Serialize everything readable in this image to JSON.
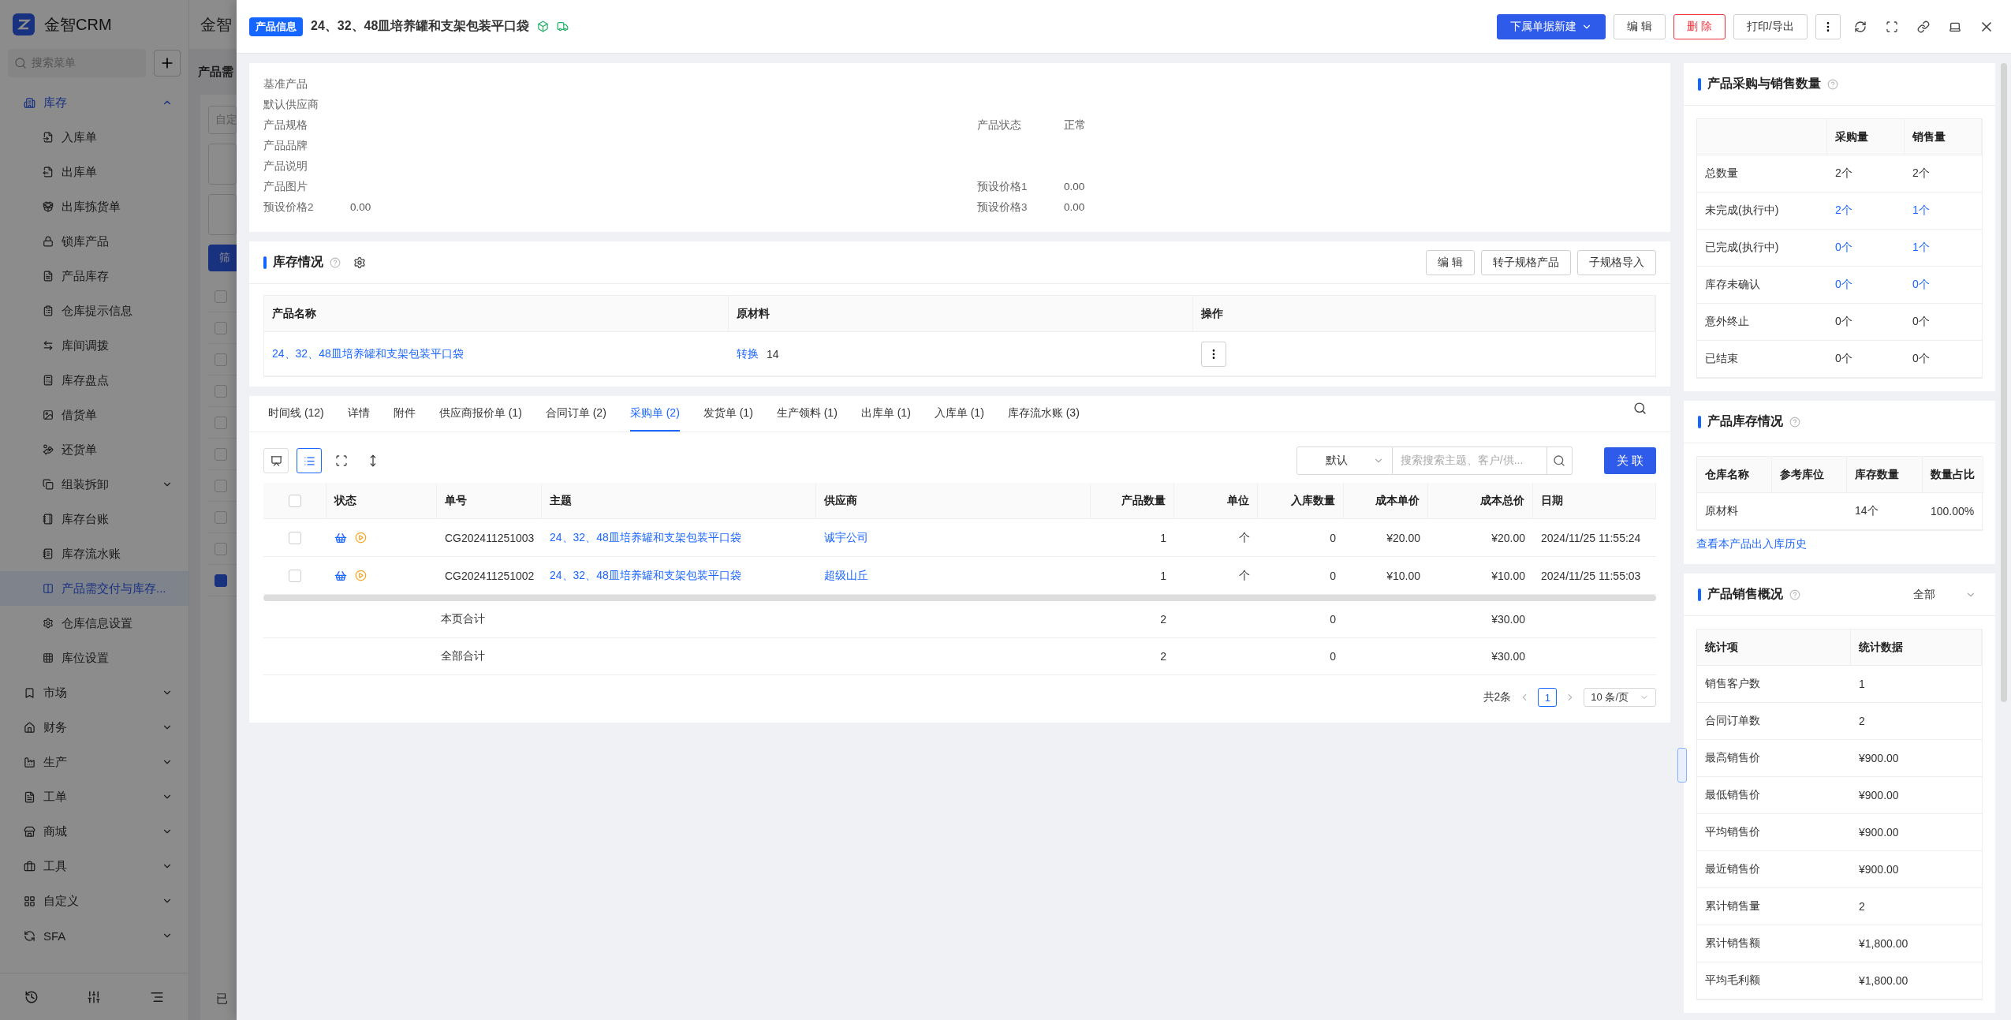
{
  "backdrop": {
    "app_name": "金智CRM",
    "search_placeholder": "搜索菜单",
    "menu": [
      {
        "label": "库存",
        "expanded": true,
        "children": [
          {
            "label": "入库单",
            "kind": "item",
            "selected": false
          },
          {
            "label": "出库单",
            "kind": "item",
            "selected": false
          },
          {
            "label": "出库拣货单",
            "kind": "item",
            "selected": false
          },
          {
            "label": "锁库产品",
            "kind": "item",
            "selected": false
          },
          {
            "label": "产品库存",
            "kind": "item",
            "selected": false
          },
          {
            "label": "仓库提示信息",
            "kind": "item",
            "selected": false
          },
          {
            "label": "库间调拨",
            "kind": "item",
            "selected": false
          },
          {
            "label": "库存盘点",
            "kind": "item",
            "selected": false
          },
          {
            "label": "借货单",
            "kind": "item",
            "selected": false
          },
          {
            "label": "还货单",
            "kind": "item",
            "selected": false
          },
          {
            "label": "组装拆卸",
            "kind": "group",
            "selected": false
          },
          {
            "label": "库存台账",
            "kind": "item",
            "selected": false
          },
          {
            "label": "库存流水账",
            "kind": "item",
            "selected": false
          },
          {
            "label": "产品需交付与库存...",
            "kind": "item",
            "selected": true
          },
          {
            "label": "仓库信息设置",
            "kind": "item",
            "selected": false
          },
          {
            "label": "库位设置",
            "kind": "item",
            "selected": false
          }
        ]
      },
      {
        "label": "市场",
        "expanded": false
      },
      {
        "label": "财务",
        "expanded": false
      },
      {
        "label": "生产",
        "expanded": false
      },
      {
        "label": "工单",
        "expanded": false
      },
      {
        "label": "商城",
        "expanded": false
      },
      {
        "label": "工具",
        "expanded": false
      },
      {
        "label": "自定义",
        "expanded": false
      },
      {
        "label": "SFA",
        "expanded": false
      }
    ],
    "header_title": "金智",
    "page_title": "产品需",
    "field_placeholder": "自定",
    "filter_button": "筛",
    "footer_text": "已",
    "rows": [
      {
        "checked": false
      },
      {
        "checked": false
      },
      {
        "checked": false
      },
      {
        "checked": false
      },
      {
        "checked": false
      },
      {
        "checked": false
      },
      {
        "checked": false
      },
      {
        "checked": false
      },
      {
        "checked": false
      },
      {
        "checked": true
      }
    ]
  },
  "drawer": {
    "badge": "产品信息",
    "title": "24、32、48皿培养罐和支架包装平口袋",
    "actions": [
      {
        "label": "下属单据新建",
        "kind": "primary"
      },
      {
        "label": "编 辑",
        "kind": "default"
      },
      {
        "label": "删 除",
        "kind": "danger"
      },
      {
        "label": "打印/导出",
        "kind": "default"
      }
    ]
  },
  "info": {
    "rows": [
      {
        "left": {
          "label": "基准产品"
        }
      },
      {
        "left": {
          "label": "默认供应商"
        }
      },
      {
        "left": {
          "label": "产品规格"
        },
        "right": {
          "label": "产品状态",
          "value": "正常"
        }
      },
      {
        "left": {
          "label": "产品品牌"
        }
      },
      {
        "left": {
          "label": "产品说明"
        }
      },
      {
        "left": {
          "label": "产品图片"
        },
        "right": {
          "label": "预设价格1",
          "value": "0.00"
        }
      },
      {
        "left": {
          "label": "预设价格2",
          "value": "0.00"
        },
        "right": {
          "label": "预设价格3",
          "value": "0.00"
        }
      }
    ]
  },
  "stock": {
    "title": "库存情况",
    "buttons": [
      "编 辑",
      "转子规格产品",
      "子规格导入"
    ],
    "columns": [
      "产品名称",
      "原材料",
      "操作"
    ],
    "rows": [
      {
        "name": "24、32、48皿培养罐和支架包装平口袋",
        "action": "转换",
        "quantity": "14"
      }
    ]
  },
  "tabs": [
    {
      "label": "时间线 (12)",
      "selected": false
    },
    {
      "label": "详情",
      "selected": false
    },
    {
      "label": "附件",
      "selected": false
    },
    {
      "label": "供应商报价单 (1)",
      "selected": false
    },
    {
      "label": "合同订单 (2)",
      "selected": false
    },
    {
      "label": "采购单 (2)",
      "selected": true
    },
    {
      "label": "发货单 (1)",
      "selected": false
    },
    {
      "label": "生产领料 (1)",
      "selected": false
    },
    {
      "label": "出库单 (1)",
      "selected": false
    },
    {
      "label": "入库单 (1)",
      "selected": false
    },
    {
      "label": "库存流水账 (3)",
      "selected": false
    }
  ],
  "orders": {
    "select_all": {
      "checked": false
    },
    "view_modes": [
      {
        "selected": false
      },
      {
        "selected": true
      }
    ],
    "filter_select": "默认",
    "search_placeholder": "搜索搜索主题、客户/供...",
    "link_button": "关 联",
    "columns": [
      "状态",
      "单号",
      "主题",
      "供应商",
      "产品数量",
      "单位",
      "入库数量",
      "成本单价",
      "成本总价",
      "日期"
    ],
    "rows": [
      {
        "checked": false,
        "number": "CG202411251003",
        "subject": "24、32、48皿培养罐和支架包装平口袋",
        "supplier": "诚宇公司",
        "qty": "1",
        "unit": "个",
        "in_qty": "0",
        "unit_cost": "¥20.00",
        "total_cost": "¥20.00",
        "date": "2024/11/25 11:55:24"
      },
      {
        "checked": false,
        "number": "CG202411251002",
        "subject": "24、32、48皿培养罐和支架包装平口袋",
        "supplier": "超级山丘",
        "qty": "1",
        "unit": "个",
        "in_qty": "0",
        "unit_cost": "¥10.00",
        "total_cost": "¥10.00",
        "date": "2024/11/25 11:55:03"
      }
    ],
    "totals": [
      {
        "label": "本页合计",
        "qty": "2",
        "in_qty": "0",
        "total_cost": "¥30.00"
      },
      {
        "label": "全部合计",
        "qty": "2",
        "in_qty": "0",
        "total_cost": "¥30.00"
      }
    ],
    "pagination": {
      "total": "共2条",
      "page": "1",
      "page_size": "10 条/页"
    }
  },
  "purchase_sales": {
    "title": "产品采购与销售数量",
    "columns": [
      "采购量",
      "销售量"
    ],
    "rows": [
      {
        "label": "总数量",
        "cells": [
          {
            "text": "2个",
            "link": false
          },
          {
            "text": "2个",
            "link": false
          }
        ]
      },
      {
        "label": "未完成(执行中)",
        "cells": [
          {
            "text": "2个",
            "link": true
          },
          {
            "text": "1个",
            "link": true
          }
        ]
      },
      {
        "label": "已完成(执行中)",
        "cells": [
          {
            "text": "0个",
            "link": true
          },
          {
            "text": "1个",
            "link": true
          }
        ]
      },
      {
        "label": "库存未确认",
        "cells": [
          {
            "text": "0个",
            "link": true
          },
          {
            "text": "0个",
            "link": true
          }
        ]
      },
      {
        "label": "意外终止",
        "cells": [
          {
            "text": "0个",
            "link": false
          },
          {
            "text": "0个",
            "link": false
          }
        ]
      },
      {
        "label": "已结束",
        "cells": [
          {
            "text": "0个",
            "link": false
          },
          {
            "text": "0个",
            "link": false
          }
        ]
      }
    ]
  },
  "inventory": {
    "title": "产品库存情况",
    "columns": [
      "仓库名称",
      "参考库位",
      "库存数量",
      "数量占比"
    ],
    "rows": [
      {
        "warehouse": "原材料",
        "quantity": "14个",
        "share": "100.00%"
      }
    ],
    "history_link": "查看本产品出入库历史"
  },
  "sales": {
    "title": "产品销售概况",
    "filter": "全部",
    "columns": [
      "统计项",
      "统计数据"
    ],
    "rows": [
      [
        "销售客户数",
        "1"
      ],
      [
        "合同订单数",
        "2"
      ],
      [
        "最高销售价",
        "¥900.00"
      ],
      [
        "最低销售价",
        "¥900.00"
      ],
      [
        "平均销售价",
        "¥900.00"
      ],
      [
        "最近销售价",
        "¥900.00"
      ],
      [
        "累计销售量",
        "2"
      ],
      [
        "累计销售额",
        "¥1,800.00"
      ],
      [
        "平均毛利额",
        "¥1,800.00"
      ]
    ]
  }
}
